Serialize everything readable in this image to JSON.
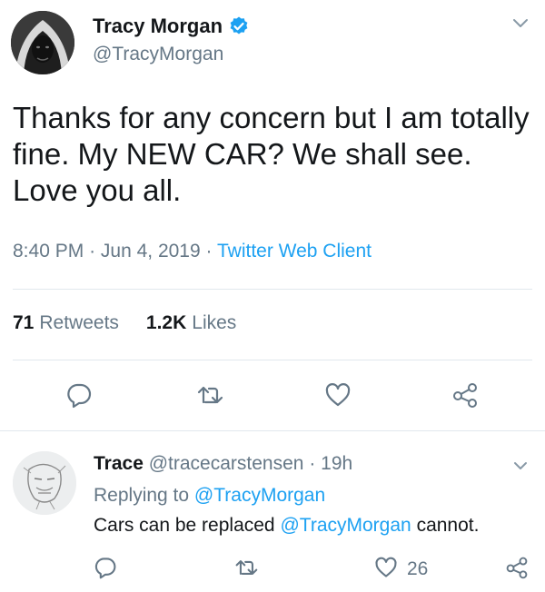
{
  "main_tweet": {
    "author_name": "Tracy Morgan",
    "author_handle": "@TracyMorgan",
    "verified": true,
    "text": "Thanks for any concern but I am totally fine.  My NEW CAR?  We shall see. Love you all.",
    "time": "8:40 PM",
    "date": "Jun 4, 2019",
    "source": "Twitter Web Client",
    "separator": "·",
    "retweets_count": "71",
    "retweets_label": "Retweets",
    "likes_count": "1.2K",
    "likes_label": "Likes",
    "actions": [
      "reply-icon",
      "retweet-icon",
      "like-icon",
      "share-icon"
    ]
  },
  "reply_tweet": {
    "author_name": "Trace",
    "author_handle": "@tracecarstensen",
    "separator": "·",
    "age": "19h",
    "replying_prefix": "Replying to",
    "replying_to": "@TracyMorgan",
    "text_before": "Cars can be replaced",
    "text_mention": "@TracyMorgan",
    "text_after": "cannot.",
    "like_count": "26",
    "actions": [
      "reply-icon",
      "retweet-icon",
      "like-icon",
      "share-icon"
    ]
  },
  "colors": {
    "accent": "#1da1f2",
    "secondary_text": "#657786",
    "primary_text": "#14171a",
    "divider": "#e1e8ed"
  }
}
